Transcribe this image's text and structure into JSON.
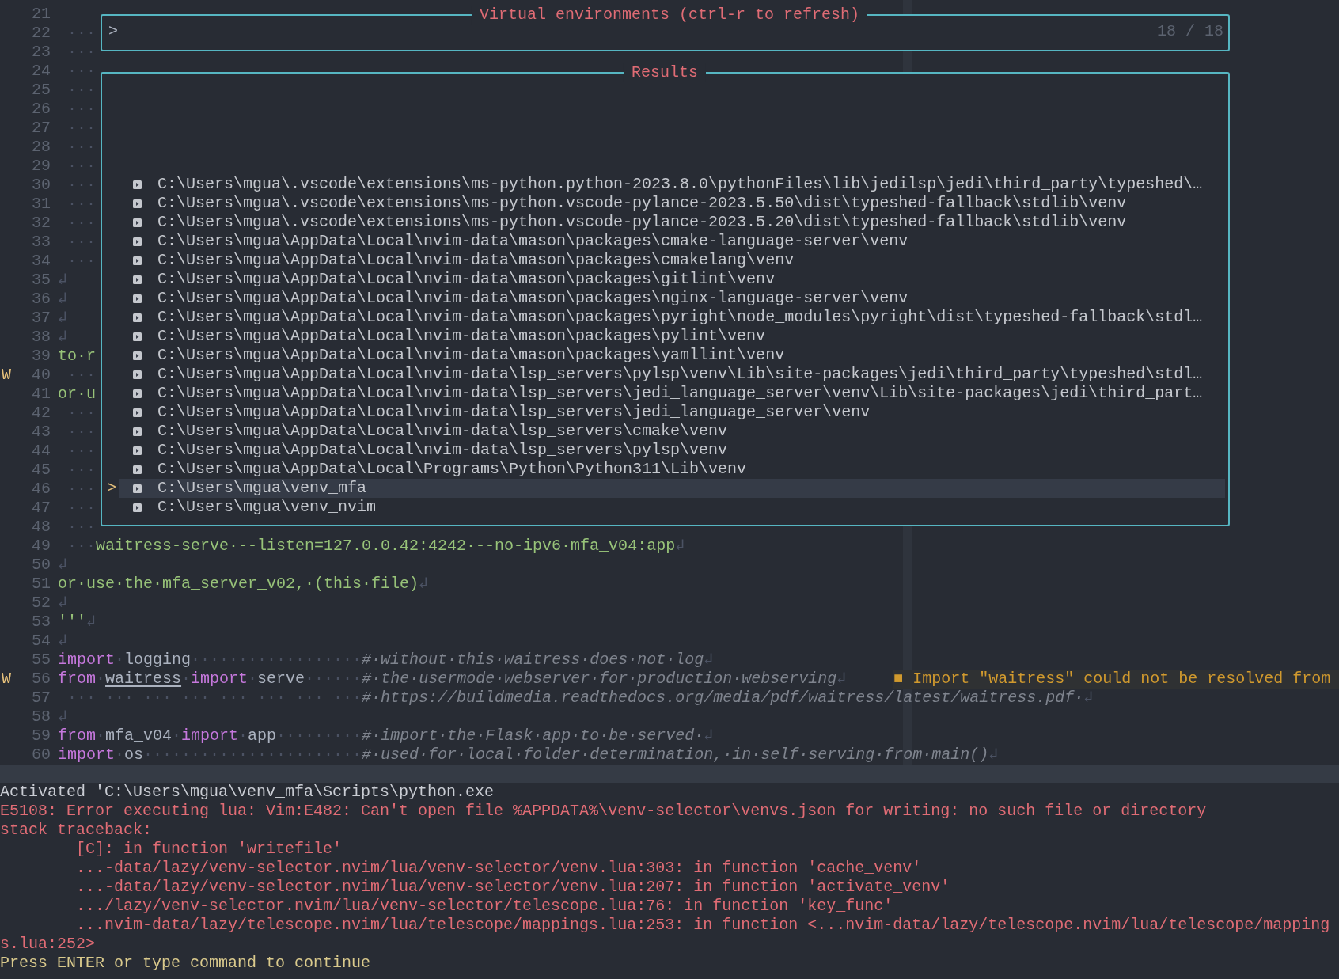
{
  "editor": {
    "lines": [
      {
        "number": "21"
      },
      {
        "number": "22",
        "segments": [
          {
            "kind": "whitespace",
            "text": " ···"
          }
        ]
      },
      {
        "number": "23",
        "segments": [
          {
            "kind": "whitespace",
            "text": " ···"
          }
        ]
      },
      {
        "number": "24",
        "segments": [
          {
            "kind": "whitespace",
            "text": " ···"
          }
        ]
      },
      {
        "number": "25",
        "segments": [
          {
            "kind": "whitespace",
            "text": " ···"
          }
        ]
      },
      {
        "number": "26",
        "segments": [
          {
            "kind": "whitespace",
            "text": " ···"
          }
        ]
      },
      {
        "number": "27",
        "segments": [
          {
            "kind": "whitespace",
            "text": " ···"
          }
        ]
      },
      {
        "number": "28",
        "segments": [
          {
            "kind": "whitespace",
            "text": " ···"
          }
        ]
      },
      {
        "number": "29",
        "segments": [
          {
            "kind": "whitespace",
            "text": " ···"
          }
        ]
      },
      {
        "number": "30",
        "segments": [
          {
            "kind": "whitespace",
            "text": " ···"
          }
        ]
      },
      {
        "number": "31",
        "segments": [
          {
            "kind": "whitespace",
            "text": " ···"
          }
        ]
      },
      {
        "number": "32",
        "segments": [
          {
            "kind": "whitespace",
            "text": " ···"
          }
        ]
      },
      {
        "number": "33",
        "segments": [
          {
            "kind": "whitespace",
            "text": " ···"
          }
        ]
      },
      {
        "number": "34",
        "segments": [
          {
            "kind": "whitespace",
            "text": " ···"
          }
        ]
      },
      {
        "number": "35",
        "segments": [
          {
            "kind": "whitespace",
            "text": "↲"
          }
        ]
      },
      {
        "number": "36",
        "segments": [
          {
            "kind": "whitespace",
            "text": "↲"
          }
        ]
      },
      {
        "number": "37",
        "segments": [
          {
            "kind": "whitespace",
            "text": "↲"
          }
        ]
      },
      {
        "number": "38",
        "segments": [
          {
            "kind": "whitespace",
            "text": "↲"
          }
        ]
      },
      {
        "number": "39",
        "segments": [
          {
            "kind": "string",
            "text": "to·r"
          }
        ]
      },
      {
        "number": "40",
        "sign": "W",
        "segments": [
          {
            "kind": "whitespace",
            "text": " ···"
          }
        ]
      },
      {
        "number": "41",
        "segments": [
          {
            "kind": "string",
            "text": "or·u"
          }
        ]
      },
      {
        "number": "42",
        "segments": [
          {
            "kind": "whitespace",
            "text": " ···"
          }
        ]
      },
      {
        "number": "43",
        "segments": [
          {
            "kind": "whitespace",
            "text": " ···"
          }
        ]
      },
      {
        "number": "44",
        "segments": [
          {
            "kind": "whitespace",
            "text": " ···"
          }
        ]
      },
      {
        "number": "45",
        "segments": [
          {
            "kind": "whitespace",
            "text": " ···"
          }
        ]
      },
      {
        "number": "46",
        "segments": [
          {
            "kind": "whitespace",
            "text": " ···"
          }
        ]
      },
      {
        "number": "47",
        "segments": [
          {
            "kind": "whitespace",
            "text": " ···"
          }
        ]
      },
      {
        "number": "48",
        "segments": [
          {
            "kind": "whitespace",
            "text": " ···"
          }
        ]
      },
      {
        "number": "49",
        "segments": [
          {
            "kind": "whitespace",
            "text": " ···"
          },
          {
            "kind": "string",
            "text": "waitress-serve·--listen=127.0.0.42:4242·--no-ipv6·mfa_v04:app"
          },
          {
            "kind": "whitespace",
            "text": "↲"
          }
        ]
      },
      {
        "number": "50",
        "segments": [
          {
            "kind": "whitespace",
            "text": "↲"
          }
        ]
      },
      {
        "number": "51",
        "segments": [
          {
            "kind": "string",
            "text": "or·use·the·mfa_server_v02,·(this·file)"
          },
          {
            "kind": "whitespace",
            "text": "↲"
          }
        ]
      },
      {
        "number": "52",
        "segments": [
          {
            "kind": "whitespace",
            "text": "↲"
          }
        ]
      },
      {
        "number": "53",
        "segments": [
          {
            "kind": "string",
            "text": "'''"
          },
          {
            "kind": "whitespace",
            "text": "↲"
          }
        ]
      },
      {
        "number": "54",
        "segments": [
          {
            "kind": "whitespace",
            "text": "↲"
          }
        ]
      },
      {
        "number": "55",
        "segments": [
          {
            "kind": "keyword",
            "text": "import"
          },
          {
            "kind": "whitespace",
            "text": "·"
          },
          {
            "kind": "ident",
            "text": "logging"
          },
          {
            "kind": "whitespace",
            "text": "··················"
          },
          {
            "kind": "comment",
            "text": "#·without·this·waitress·does·not·log"
          },
          {
            "kind": "whitespace",
            "text": "↲"
          }
        ]
      },
      {
        "number": "56",
        "sign": "W",
        "segments": [
          {
            "kind": "keyword",
            "text": "from"
          },
          {
            "kind": "whitespace",
            "text": "·"
          },
          {
            "kind": "warning",
            "text": "waitress"
          },
          {
            "kind": "whitespace",
            "text": "·"
          },
          {
            "kind": "keyword",
            "text": "import"
          },
          {
            "kind": "whitespace",
            "text": "·"
          },
          {
            "kind": "ident",
            "text": "serve"
          },
          {
            "kind": "whitespace",
            "text": "······"
          },
          {
            "kind": "comment",
            "text": "#·the·usermode·webserver·for·production·webserving"
          },
          {
            "kind": "whitespace",
            "text": "↲"
          }
        ],
        "diagnostic": "■ Import \"waitress\" could not be resolved from"
      },
      {
        "number": "57",
        "segments": [
          {
            "kind": "whitespace",
            "text": " ··· ··· ··· ··· ··· ··· ··· ···"
          },
          {
            "kind": "comment",
            "text": "#·https://buildmedia.readthedocs.org/media/pdf/waitress/latest/waitress.pdf·"
          },
          {
            "kind": "whitespace",
            "text": "↲"
          }
        ]
      },
      {
        "number": "58",
        "segments": [
          {
            "kind": "whitespace",
            "text": "↲"
          }
        ]
      },
      {
        "number": "59",
        "segments": [
          {
            "kind": "keyword",
            "text": "from"
          },
          {
            "kind": "whitespace",
            "text": "·"
          },
          {
            "kind": "ident",
            "text": "mfa_v04"
          },
          {
            "kind": "whitespace",
            "text": "·"
          },
          {
            "kind": "keyword",
            "text": "import"
          },
          {
            "kind": "whitespace",
            "text": "·"
          },
          {
            "kind": "ident",
            "text": "app"
          },
          {
            "kind": "whitespace",
            "text": "·········"
          },
          {
            "kind": "comment",
            "text": "#·import·the·Flask·app·to·be·served·"
          },
          {
            "kind": "whitespace",
            "text": "↲"
          }
        ]
      },
      {
        "number": "60",
        "segments": [
          {
            "kind": "keyword",
            "text": "import"
          },
          {
            "kind": "whitespace",
            "text": "·"
          },
          {
            "kind": "ident",
            "text": "os"
          },
          {
            "kind": "whitespace",
            "text": "·······················"
          },
          {
            "kind": "comment",
            "text": "#·used·for·local·folder·determination,·in·self·serving·from·main()"
          },
          {
            "kind": "whitespace",
            "text": "↲"
          }
        ]
      }
    ]
  },
  "picker": {
    "title": "Virtual environments (ctrl-r to refresh)",
    "prompt": ">",
    "count": "18 / 18",
    "results_title": "Results",
    "selection_marker": ">",
    "results": [
      {
        "path": "C:\\Users\\mgua\\.vscode\\extensions\\ms-python.python-2023.8.0\\pythonFiles\\lib\\jedilsp\\jedi\\third_party\\typeshed\\…",
        "selected": false
      },
      {
        "path": "C:\\Users\\mgua\\.vscode\\extensions\\ms-python.vscode-pylance-2023.5.50\\dist\\typeshed-fallback\\stdlib\\venv",
        "selected": false
      },
      {
        "path": "C:\\Users\\mgua\\.vscode\\extensions\\ms-python.vscode-pylance-2023.5.20\\dist\\typeshed-fallback\\stdlib\\venv",
        "selected": false
      },
      {
        "path": "C:\\Users\\mgua\\AppData\\Local\\nvim-data\\mason\\packages\\cmake-language-server\\venv",
        "selected": false
      },
      {
        "path": "C:\\Users\\mgua\\AppData\\Local\\nvim-data\\mason\\packages\\cmakelang\\venv",
        "selected": false
      },
      {
        "path": "C:\\Users\\mgua\\AppData\\Local\\nvim-data\\mason\\packages\\gitlint\\venv",
        "selected": false
      },
      {
        "path": "C:\\Users\\mgua\\AppData\\Local\\nvim-data\\mason\\packages\\nginx-language-server\\venv",
        "selected": false
      },
      {
        "path": "C:\\Users\\mgua\\AppData\\Local\\nvim-data\\mason\\packages\\pyright\\node_modules\\pyright\\dist\\typeshed-fallback\\stdl…",
        "selected": false
      },
      {
        "path": "C:\\Users\\mgua\\AppData\\Local\\nvim-data\\mason\\packages\\pylint\\venv",
        "selected": false
      },
      {
        "path": "C:\\Users\\mgua\\AppData\\Local\\nvim-data\\mason\\packages\\yamllint\\venv",
        "selected": false
      },
      {
        "path": "C:\\Users\\mgua\\AppData\\Local\\nvim-data\\lsp_servers\\pylsp\\venv\\Lib\\site-packages\\jedi\\third_party\\typeshed\\stdl…",
        "selected": false
      },
      {
        "path": "C:\\Users\\mgua\\AppData\\Local\\nvim-data\\lsp_servers\\jedi_language_server\\venv\\Lib\\site-packages\\jedi\\third_part…",
        "selected": false
      },
      {
        "path": "C:\\Users\\mgua\\AppData\\Local\\nvim-data\\lsp_servers\\jedi_language_server\\venv",
        "selected": false
      },
      {
        "path": "C:\\Users\\mgua\\AppData\\Local\\nvim-data\\lsp_servers\\cmake\\venv",
        "selected": false
      },
      {
        "path": "C:\\Users\\mgua\\AppData\\Local\\nvim-data\\lsp_servers\\pylsp\\venv",
        "selected": false
      },
      {
        "path": "C:\\Users\\mgua\\AppData\\Local\\Programs\\Python\\Python311\\Lib\\venv",
        "selected": false
      },
      {
        "path": "C:\\Users\\mgua\\venv_mfa",
        "selected": true
      },
      {
        "path": "C:\\Users\\mgua\\venv_nvim",
        "selected": false
      }
    ]
  },
  "messages": [
    {
      "kind": "info",
      "text": "Activated 'C:\\Users\\mgua\\venv_mfa\\Scripts\\python.exe"
    },
    {
      "kind": "error",
      "text": "E5108: Error executing lua: Vim:E482: Can't open file %APPDATA%\\venv-selector\\venvs.json for writing: no such file or directory"
    },
    {
      "kind": "error",
      "text": "stack traceback:"
    },
    {
      "kind": "error",
      "text": "        [C]: in function 'writefile'"
    },
    {
      "kind": "error",
      "text": "        ...-data/lazy/venv-selector.nvim/lua/venv-selector/venv.lua:303: in function 'cache_venv'"
    },
    {
      "kind": "error",
      "text": "        ...-data/lazy/venv-selector.nvim/lua/venv-selector/venv.lua:207: in function 'activate_venv'"
    },
    {
      "kind": "error",
      "text": "        .../lazy/venv-selector.nvim/lua/venv-selector/telescope.lua:76: in function 'key_func'"
    },
    {
      "kind": "error",
      "text": "        ...nvim-data/lazy/telescope.nvim/lua/telescope/mappings.lua:253: in function <...nvim-data/lazy/telescope.nvim/lua/telescope/mapping"
    },
    {
      "kind": "error",
      "text": "s.lua:252>"
    },
    {
      "kind": "prompt",
      "text": "Press ENTER or type command to continue"
    }
  ]
}
